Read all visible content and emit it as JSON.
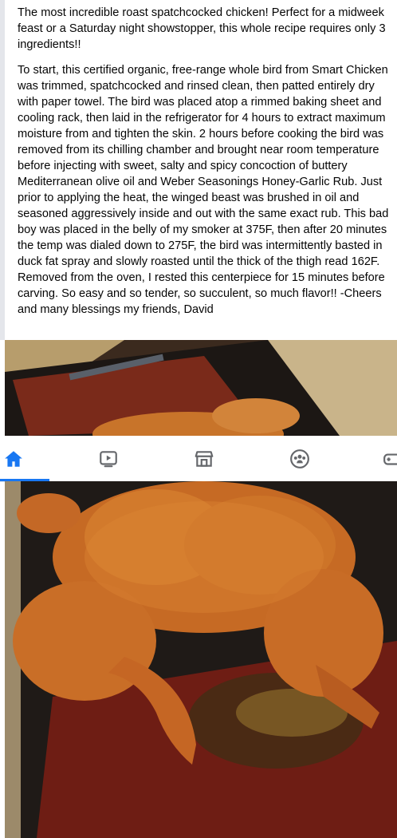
{
  "post": {
    "paragraphs": [
      "The most incredible roast spatchcocked chicken! Perfect for a midweek feast or a Saturday night showstopper, this whole recipe requires only 3 ingredients!!",
      "To start, this certified organic, free-range whole bird from Smart Chicken was trimmed, spatchcocked and rinsed clean, then patted entirely dry with paper towel. The bird was placed atop a rimmed baking sheet and cooling rack, then laid in the refrigerator for 4 hours to extract maximum moisture from and tighten the skin. 2 hours before cooking the bird was removed from its chilling chamber and brought near room temperature before injecting with sweet, salty and spicy concoction of buttery Mediterranean olive oil and Weber Seasonings Honey-Garlic Rub. Just prior to applying the heat, the winged beast was brushed in oil and seasoned aggressively inside and out with the same exact rub. This bad boy was placed in the belly of my smoker at 375F, then after 20 minutes the temp was dialed down to 275F, the bird was intermittently basted in duck fat spray and slowly roasted until the thick of the thigh read 162F. Removed from the oven, I rested this centerpiece for 15 minutes before carving. So easy and so tender, so succulent, so much flavor!! -Cheers and many blessings my friends, David"
    ]
  },
  "nav": {
    "items": [
      {
        "icon": "home-icon",
        "active": true
      },
      {
        "icon": "video-icon",
        "active": false
      },
      {
        "icon": "marketplace-icon",
        "active": false
      },
      {
        "icon": "groups-icon",
        "active": false
      },
      {
        "icon": "gaming-icon",
        "active": false
      }
    ],
    "active_color": "#1877f2",
    "icon_color": "#65676b"
  },
  "photos": [
    {
      "icon": "roast-chicken-photo"
    },
    {
      "icon": "roast-chicken-photo"
    }
  ]
}
